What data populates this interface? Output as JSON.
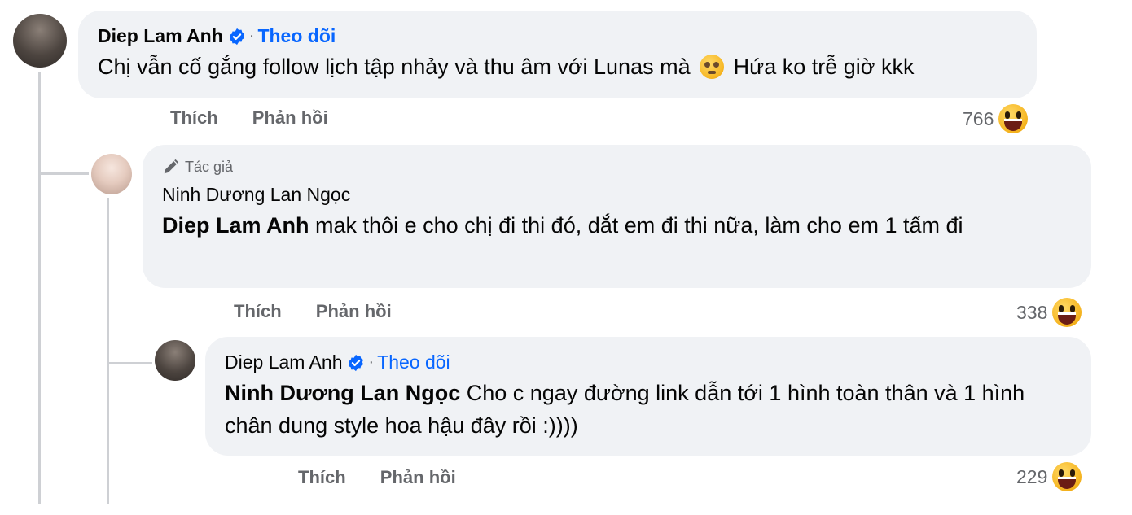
{
  "comments": [
    {
      "author": "Diep Lam Anh",
      "verified": true,
      "separator": "·",
      "follow_label": "Theo dõi",
      "mention": "",
      "text_before_emoji": "Chị vẫn cố gắng follow lịch tập nhảy và thu âm với Lunas mà",
      "inline_emoji": "pleading-face",
      "text_after_emoji": "Hứa ko trễ giờ kkk",
      "actions": {
        "like": "Thích",
        "reply": "Phản hồi"
      },
      "reaction_count": "766",
      "reaction_icon": "laughing-face"
    },
    {
      "author_tag": "Tác giả",
      "author": "Ninh Dương Lan Ngọc",
      "mention": "Diep Lam Anh",
      "text": "mak thôi e cho chị đi thi đó, dắt em đi thi nữa, làm cho em 1 tấm đi",
      "actions": {
        "like": "Thích",
        "reply": "Phản hồi"
      },
      "reaction_count": "338",
      "reaction_icon": "laughing-face"
    },
    {
      "author": "Diep Lam Anh",
      "verified": true,
      "separator": "·",
      "follow_label": "Theo dõi",
      "mention": "Ninh Dương Lan Ngọc",
      "text": "Cho c ngay đường link dẫn tới 1 hình toàn thân và 1 hình chân dung style hoa hậu đây rồi :))))",
      "actions": {
        "like": "Thích",
        "reply": "Phản hồi"
      },
      "reaction_count": "229",
      "reaction_icon": "laughing-face"
    }
  ],
  "colors": {
    "bubble": "#f0f2f5",
    "link": "#0866ff",
    "muted": "#65676b",
    "thread_line": "#ced0d4"
  }
}
